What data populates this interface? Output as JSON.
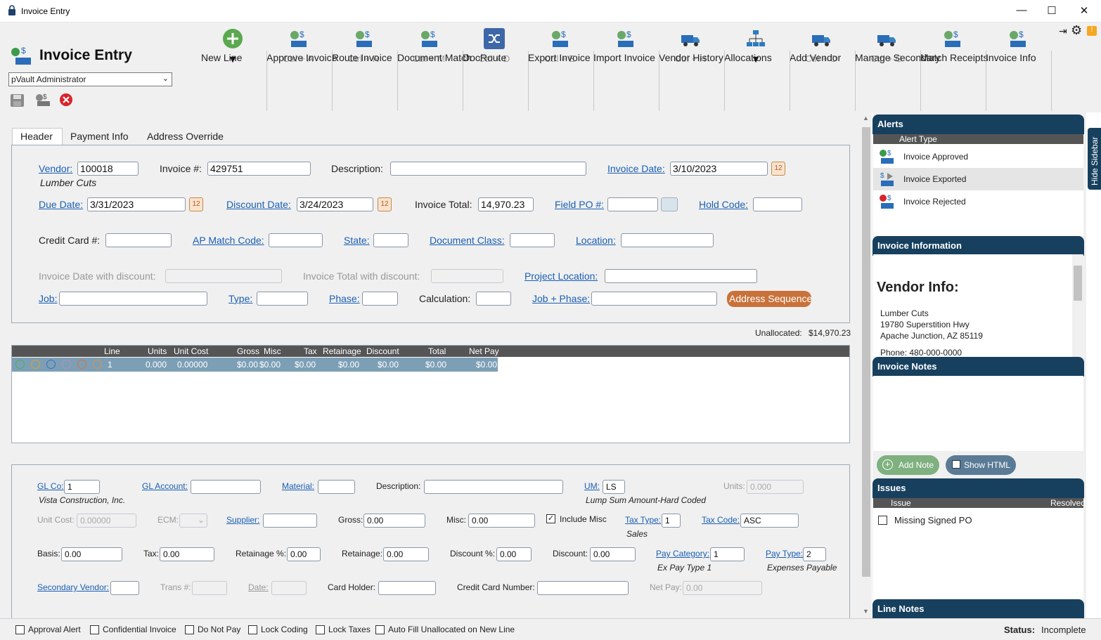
{
  "window": {
    "title": "Invoice Entry"
  },
  "app": {
    "title": "Invoice Entry",
    "user_select": "pVault Administrator"
  },
  "ribbon": [
    {
      "label": "New Line",
      "shortcut": "▼",
      "icon": "plus-circle-icon"
    },
    {
      "label": "Approve Invoice",
      "shortcut": "Ctrl + A",
      "icon": "approve-invoice-icon"
    },
    {
      "label": "Route Invoice",
      "shortcut": "Ctrl + R",
      "icon": "route-invoice-icon"
    },
    {
      "label": "Document Match",
      "shortcut": "Ctrl + M",
      "icon": "document-match-icon"
    },
    {
      "label": "DocRoute",
      "shortcut": "Ctrl + D",
      "icon": "shuffle-icon"
    },
    {
      "label": "Export Invoice",
      "shortcut": "Ctrl + E",
      "icon": "export-invoice-icon",
      "disabled": true
    },
    {
      "label": "Import Invoice",
      "shortcut": "",
      "icon": "import-invoice-icon"
    },
    {
      "label": "Vendor History",
      "shortcut": "Ctrl + H",
      "icon": "truck-clock-icon"
    },
    {
      "label": "Allocations",
      "shortcut": "▼",
      "icon": "org-chart-icon"
    },
    {
      "label": "Add Vendor",
      "shortcut": "Ctrl + O",
      "icon": "add-truck-icon"
    },
    {
      "label": "Manage Secondary",
      "shortcut": "Ctrl + G",
      "icon": "truck-gear-icon"
    },
    {
      "label": "Match Receipts",
      "shortcut": "",
      "icon": "match-receipts-icon"
    },
    {
      "label": "Invoice Info",
      "shortcut": "",
      "icon": "invoice-info-icon"
    }
  ],
  "tabs": [
    "Header",
    "Payment Info",
    "Address Override"
  ],
  "header": {
    "vendor_label": "Vendor:",
    "vendor": "100018",
    "vendor_name": "Lumber Cuts",
    "invoice_no_label": "Invoice #:",
    "invoice_no": "429751",
    "description_label": "Description:",
    "description": "",
    "invoice_date_label": "Invoice Date:",
    "invoice_date": "3/10/2023",
    "due_date_label": "Due Date:",
    "due_date": "3/31/2023",
    "discount_date_label": "Discount Date:",
    "discount_date": "3/24/2023",
    "invoice_total_label": "Invoice Total:",
    "invoice_total": "14,970.23",
    "field_po_label": "Field PO #:",
    "hold_code_label": "Hold Code:",
    "credit_card_label": "Credit Card #:",
    "ap_match_label": "AP Match Code:",
    "state_label": "State:",
    "doc_class_label": "Document Class:",
    "location_label": "Location:",
    "inv_date_disc_label": "Invoice Date with discount:",
    "inv_total_disc_label": "Invoice Total with discount:",
    "project_location_label": "Project Location:",
    "job_label": "Job:",
    "type_label": "Type:",
    "phase_label": "Phase:",
    "calculation_label": "Calculation:",
    "job_phase_label": "Job + Phase:",
    "address_sequence": "Address Sequence"
  },
  "unallocated": {
    "label": "Unallocated:",
    "value": "$14,970.23"
  },
  "grid": {
    "columns": [
      "Line",
      "Units",
      "Unit Cost",
      "Gross",
      "Misc",
      "Tax",
      "Retainage",
      "Discount",
      "Total",
      "Net Pay"
    ],
    "row": [
      "1",
      "0.000",
      "0.00000",
      "$0.00",
      "$0.00",
      "$0.00",
      "$0.00",
      "$0.00",
      "$0.00",
      "$0.00"
    ]
  },
  "line": {
    "gl_co_label": "GL Co:",
    "gl_co": "1",
    "gl_co_name": "Vista Construction, Inc.",
    "gl_account_label": "GL Account:",
    "material_label": "Material:",
    "description_label": "Description:",
    "um_label": "UM:",
    "um": "LS",
    "um_name": "Lump Sum Amount-Hard Coded",
    "units_label": "Units:",
    "units": "0.000",
    "unit_cost_label": "Unit Cost:",
    "unit_cost": "0.00000",
    "ecm_label": "ECM:",
    "supplier_label": "Supplier:",
    "gross_label": "Gross:",
    "gross": "0.00",
    "misc_label": "Misc:",
    "misc": "0.00",
    "include_misc": "Include Misc",
    "tax_type_label": "Tax Type:",
    "tax_type": "1",
    "tax_type_name": "Sales",
    "tax_code_label": "Tax Code:",
    "tax_code": "ASC",
    "basis_label": "Basis:",
    "basis": "0.00",
    "tax_label": "Tax:",
    "tax": "0.00",
    "retainage_pct_label": "Retainage %:",
    "retainage_pct": "0.00",
    "retainage_label": "Retainage:",
    "retainage": "0.00",
    "discount_pct_label": "Discount %:",
    "discount_pct": "0.00",
    "discount_label": "Discount:",
    "discount": "0.00",
    "pay_category_label": "Pay Category:",
    "pay_category": "1",
    "pay_category_name": "Ex Pay Type 1",
    "pay_type_label": "Pay Type:",
    "pay_type": "2",
    "pay_type_name": "Expenses Payable",
    "secondary_vendor_label": "Secondary Vendor:",
    "trans_label": "Trans #:",
    "date_label": "Date:",
    "card_holder_label": "Card Holder:",
    "cc_number_label": "Credit Card Number:",
    "net_pay_label": "Net Pay:",
    "net_pay": "0.00"
  },
  "sidebar": {
    "hide_label": "Hide Sidebar",
    "alerts_title": "Alerts",
    "alert_type_col": "Alert Type",
    "alerts": [
      "Invoice Approved",
      "Invoice Exported",
      "Invoice Rejected"
    ],
    "invoice_info_title": "Invoice Information",
    "vendor_info_heading": "Vendor Info:",
    "vendor_lines": [
      "Lumber Cuts",
      "19780 Superstition Hwy",
      "Apache Junction, AZ 85119",
      "Phone: 480-000-0000"
    ],
    "invoice_notes_title": "Invoice Notes",
    "add_note": "Add Note",
    "show_html": "Show HTML",
    "issues_title": "Issues",
    "issue_col": "Issue",
    "resolved_col": "Resolved",
    "issues": [
      "Missing Signed PO"
    ],
    "line_notes_title": "Line Notes"
  },
  "status": {
    "checkboxes": [
      "Approval Alert",
      "Confidential Invoice",
      "Do Not Pay",
      "Lock Coding",
      "Lock Taxes",
      "Auto Fill Unallocated on New Line"
    ],
    "status_label": "Status:",
    "status_value": "Incomplete"
  },
  "colors": {
    "accent": "#17405e",
    "link": "#1a5fb4",
    "address_btn": "#c8723a",
    "grid_row": "#7c9fb6"
  }
}
